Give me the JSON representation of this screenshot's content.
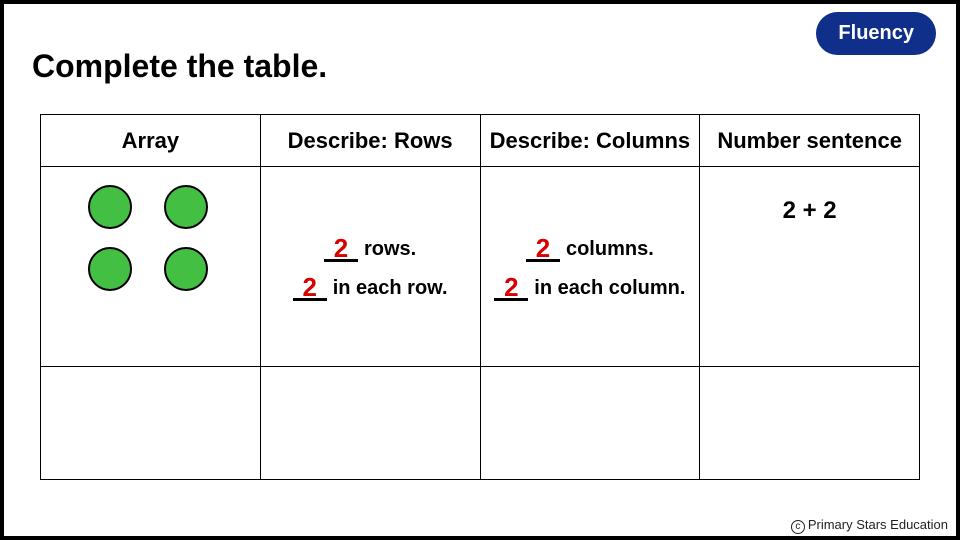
{
  "badge": "Fluency",
  "title": "Complete the table.",
  "headers": {
    "c0": "Array",
    "c1": "Describe: Rows",
    "c2": "Describe: Columns",
    "c3": "Number sentence"
  },
  "row1": {
    "rows_count": "2",
    "rows_label": "rows.",
    "in_each_row_count": "2",
    "in_each_row_label": "in each row.",
    "cols_count": "2",
    "cols_label": "columns.",
    "in_each_col_count": "2",
    "in_each_col_label": "in each column.",
    "number_sentence": "2 + 2"
  },
  "footer": "Primary Stars Education"
}
